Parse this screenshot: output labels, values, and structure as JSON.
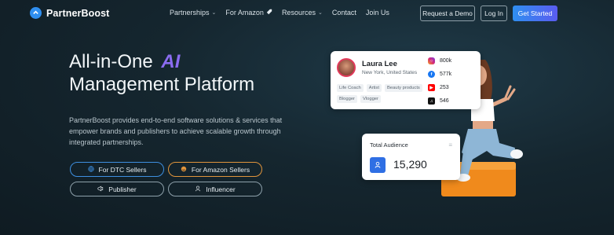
{
  "nav": {
    "brand": "PartnerBoost",
    "links": [
      {
        "label": "Partnerships",
        "icon": "chevron-down-icon"
      },
      {
        "label": "For Amazon",
        "icon": "rocket-icon"
      },
      {
        "label": "Resources",
        "icon": "chevron-down-icon"
      },
      {
        "label": "Contact"
      },
      {
        "label": "Join Us"
      }
    ],
    "request_demo": "Request a Demo",
    "login": "Log In",
    "get_started": "Get Started",
    "accent": "#2f8ff0"
  },
  "hero": {
    "title_line1": "All-in-One",
    "title_ai": "AI",
    "title_line2": "Management Platform",
    "description": "PartnerBoost provides end-to-end software solutions & services that empower brands and publishers to achieve scalable growth through integrated partnerships.",
    "buttons": [
      {
        "label": "For DTC Sellers",
        "icon": "globe-icon"
      },
      {
        "label": "For Amazon Sellers",
        "icon": "amazon-icon"
      },
      {
        "label": "Publisher",
        "icon": "megaphone-icon"
      },
      {
        "label": "Influencer",
        "icon": "user-icon"
      }
    ]
  },
  "profile": {
    "name": "Laura Lee",
    "location": "New York, United States",
    "tags": [
      "Life Coach",
      "Artist",
      "Beauty products",
      "Blogger",
      "Vlogger"
    ],
    "socials": [
      {
        "platform": "instagram-icon",
        "value": "800k"
      },
      {
        "platform": "facebook-icon",
        "value": "577k"
      },
      {
        "platform": "youtube-icon",
        "value": "253"
      },
      {
        "platform": "tiktok-icon",
        "value": "546"
      }
    ]
  },
  "audience": {
    "label": "Total Audience",
    "value": "15,290"
  }
}
